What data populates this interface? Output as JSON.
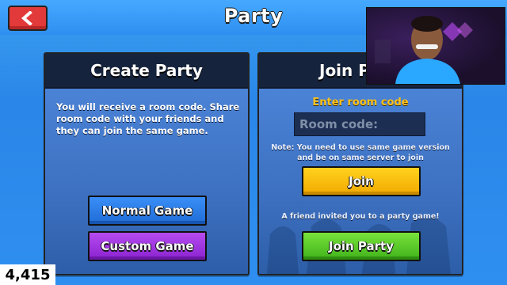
{
  "header": {
    "title": "Party",
    "back_icon": "chevron-left-icon"
  },
  "create_panel": {
    "title": "Create Party",
    "description": "You will receive a room code. Share room code with your friends and they can join the same game.",
    "normal_game_label": "Normal Game",
    "custom_game_label": "Custom Game"
  },
  "join_panel": {
    "title": "Join P",
    "enter_label": "Enter room code",
    "room_code_placeholder": "Room code:",
    "room_code_value": "",
    "note": "Note: You need to use same game version and be on same server to join",
    "join_label": "Join",
    "invite_text": "A friend invited you to a party game!",
    "join_party_label": "Join Party"
  },
  "overlay": {
    "counter": "4,415"
  },
  "colors": {
    "accent_blue": "#2f8ff0",
    "panel_header": "#16233c",
    "back_red": "#e23a3a",
    "enter_label": "#ffc21a",
    "join_yellow": "#f2a900",
    "join_party_green": "#3fb21b",
    "normal_blue": "#1f6bd6",
    "custom_purple": "#8a22cf"
  }
}
